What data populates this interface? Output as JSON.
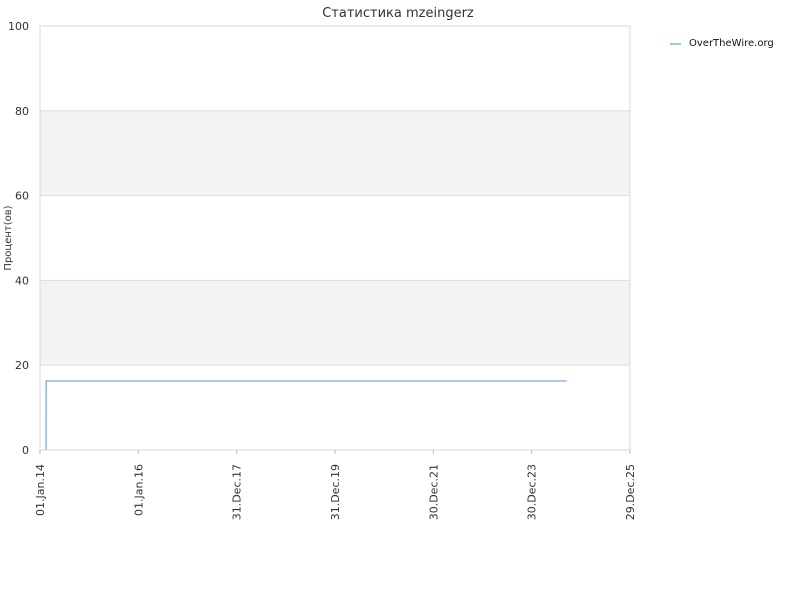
{
  "chart_data": {
    "type": "line",
    "title": "Статистика mzeingerz",
    "xlabel": "",
    "ylabel": "Процент(ов)",
    "ylim": [
      0,
      100
    ],
    "yticks": [
      0,
      20,
      40,
      60,
      80,
      100
    ],
    "xlim": [
      "2014-01-01",
      "2025-12-29"
    ],
    "xtick_labels": [
      "01.Jan.14",
      "01.Jan.16",
      "31.Dec.17",
      "31.Dec.19",
      "30.Dec.21",
      "30.Dec.23",
      "29.Dec.25"
    ],
    "xtick_dates": [
      "2014-01-01",
      "2016-01-01",
      "2017-12-31",
      "2019-12-31",
      "2021-12-30",
      "2023-12-30",
      "2025-12-29"
    ],
    "grid": true,
    "legend_position": "top-right",
    "series": [
      {
        "name": "OverTheWire.org",
        "color": "#7fb2f0",
        "x": [
          "2014-02-15",
          "2014-02-16",
          "2024-09-15"
        ],
        "y": [
          0,
          16.3,
          16.3
        ]
      }
    ]
  }
}
